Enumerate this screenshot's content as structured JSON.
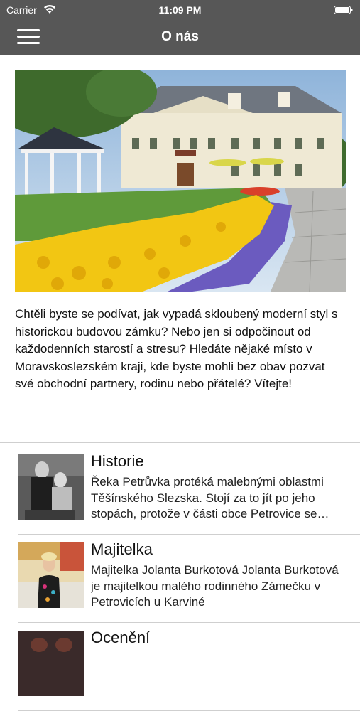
{
  "status": {
    "carrier": "Carrier",
    "time": "11:09 PM"
  },
  "nav": {
    "title": "O nás"
  },
  "intro": "Chtěli byste se podívat, jak vypadá skloubený moderní styl s historickou budovou zámku? Nebo jen si odpočinout od každodenních starostí a stresu? Hledáte nějaké místo v Moravskoslezském kraji, kde byste mohli bez obav pozvat své obchodní partnery, rodinu nebo přátelé? Vítejte!",
  "items": [
    {
      "title": "Historie",
      "desc": "Řeka Petrůvka protéká malebnými oblastmi Těšínského Slezska. Stojí za to jít po jeho stopách, protože v části obce Petrovice se nachází zámeček"
    },
    {
      "title": "Majitelka",
      "desc": "Majitelka Jolanta Burkotová Jolanta Burkotová je majitelkou malého rodinného Zámečku v Petrovicích u Karviné"
    },
    {
      "title": "Ocenění",
      "desc": ""
    }
  ]
}
